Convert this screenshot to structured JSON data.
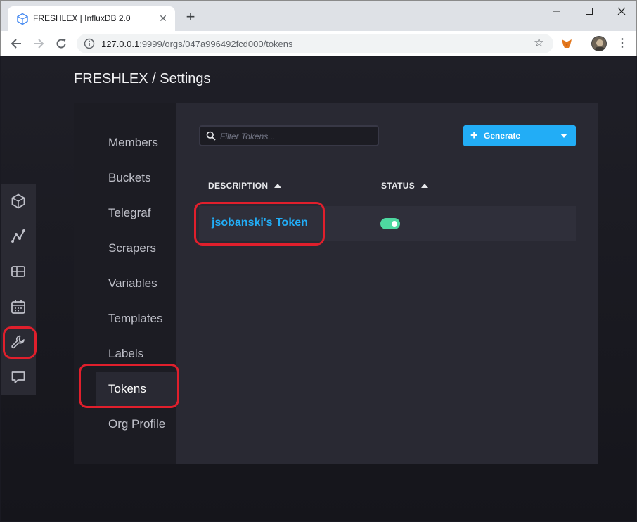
{
  "browser": {
    "tab_title": "FRESHLEX | InfluxDB 2.0",
    "tab_close": "✕",
    "new_tab": "+",
    "url_host": "127.0.0.1",
    "url_rest": ":9999/orgs/047a996492fcd000/tokens",
    "star": "☆",
    "menu": "⋮"
  },
  "page": {
    "title": "FRESHLEX / Settings"
  },
  "left_nav": {
    "icons": [
      "data-explorer-icon",
      "graph-icon",
      "dashboards-icon",
      "tasks-icon",
      "settings-wrench-icon",
      "feedback-icon"
    ],
    "active": "settings-wrench-icon"
  },
  "settings_tabs": [
    {
      "label": "Members"
    },
    {
      "label": "Buckets"
    },
    {
      "label": "Telegraf"
    },
    {
      "label": "Scrapers"
    },
    {
      "label": "Variables"
    },
    {
      "label": "Templates"
    },
    {
      "label": "Labels"
    },
    {
      "label": "Tokens"
    },
    {
      "label": "Org Profile"
    }
  ],
  "active_tab": "Tokens",
  "tokens": {
    "filter_placeholder": "Filter Tokens...",
    "generate_label": "Generate",
    "generate_plus": "+",
    "columns": [
      "DESCRIPTION",
      "STATUS"
    ],
    "rows": [
      {
        "description": "jsobanski's Token",
        "status": "active"
      }
    ]
  },
  "colors": {
    "accent": "#22adf6",
    "toggle_on": "#4ed8a0",
    "annotation": "#e01f2c"
  }
}
